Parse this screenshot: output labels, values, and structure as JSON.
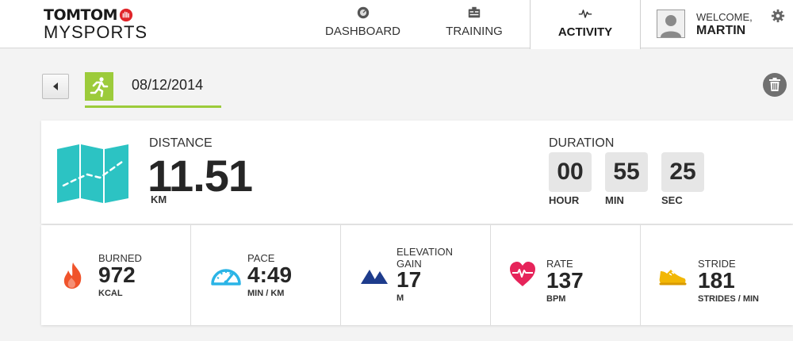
{
  "brand": {
    "line1": "TOMTOM",
    "line2": "MYSPORTS",
    "accent": "#e0262b"
  },
  "nav": {
    "dashboard": {
      "label": "DASHBOARD",
      "icon": "dashboard-icon"
    },
    "training": {
      "label": "TRAINING",
      "icon": "training-icon"
    },
    "activity": {
      "label": "ACTIVITY",
      "icon": "heartbeat-icon",
      "active": true
    }
  },
  "user": {
    "greeting": "WELCOME,",
    "name": "MARTIN"
  },
  "activity": {
    "date": "08/12/2014",
    "sport_icon": "running-icon",
    "accent": "#9ccb3b"
  },
  "summary": {
    "distance": {
      "label": "DISTANCE",
      "value": "11.51",
      "unit": "KM",
      "icon": "map-icon",
      "color": "#2cc3c3"
    },
    "duration": {
      "label": "DURATION",
      "hours": {
        "value": "00",
        "unit": "HOUR"
      },
      "minutes": {
        "value": "55",
        "unit": "MIN"
      },
      "seconds": {
        "value": "25",
        "unit": "SEC"
      }
    }
  },
  "stats": [
    {
      "label": "BURNED",
      "value": "972",
      "unit": "KCAL",
      "icon": "flame-icon",
      "color": "#f0532b"
    },
    {
      "label": "PACE",
      "value": "4:49",
      "unit": "MIN / KM",
      "icon": "speedometer-icon",
      "color": "#2ab4e6"
    },
    {
      "label": "ELEVATION GAIN",
      "label_line1": "ELEVATION",
      "label_line2": "GAIN",
      "value": "17",
      "unit": "M",
      "icon": "mountain-icon",
      "color": "#1e3c8c"
    },
    {
      "label": "RATE",
      "value": "137",
      "unit": "BPM",
      "icon": "heart-rate-icon",
      "color": "#e6245a"
    },
    {
      "label": "STRIDE",
      "value": "181",
      "unit": "STRIDES / MIN",
      "icon": "shoe-icon",
      "color": "#f2b705"
    }
  ]
}
